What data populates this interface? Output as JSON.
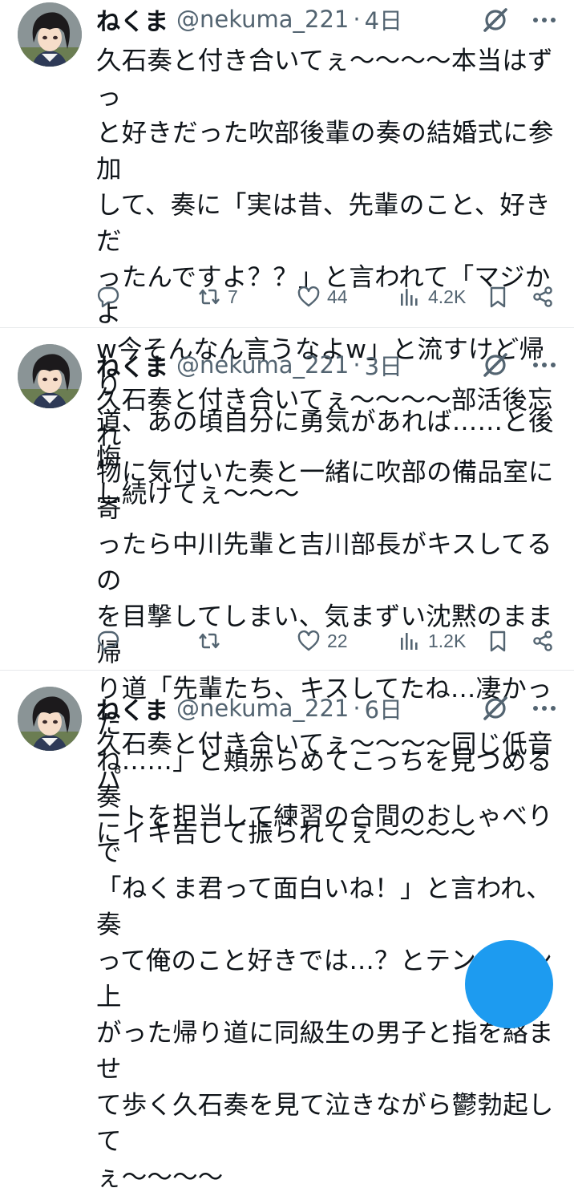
{
  "tweets": [
    {
      "name": "ねくま",
      "handle": "@nekuma_221",
      "separator": "·",
      "time": "4日",
      "text": "久石奏と付き合いてぇ〜〜〜〜本当はずっ\nと好きだった吹部後輩の奏の結婚式に参加\nして、奏に「実は昔、先輩のこと、好きだ\nったんですよ？？」と言われて「マジかよ\nw今そんなん言うなよw」と流すけど帰り\n道、あの頃自分に勇気があれば……と後悔\nし続けてぇ〜〜〜",
      "reply_count": "",
      "retweet_count": "7",
      "like_count": "44",
      "view_count": "4.2K"
    },
    {
      "name": "ねくま",
      "handle": "@nekuma_221",
      "separator": "·",
      "time": "3日",
      "text": "久石奏と付き合いてぇ〜〜〜〜部活後忘れ\n物に気付いた奏と一緒に吹部の備品室に寄\nったら中川先輩と吉川部長がキスしてるの\nを目撃してしまい、気まずい沈黙のまま帰\nり道「先輩たち、キスしてたね…凄かった\nね……」と頬赤らめてこっちを見つめる奏\nにイキ告して振られてぇ〜〜〜〜",
      "reply_count": "",
      "retweet_count": "",
      "like_count": "22",
      "view_count": "1.2K"
    },
    {
      "name": "ねくま",
      "handle": "@nekuma_221",
      "separator": "·",
      "time": "6日",
      "text": "久石奏と付き合いてぇ〜〜〜〜同じ低音パ\nートを担当して練習の合間のおしゃべりで\n「ねくま君って面白いね！」と言われ、奏\nって俺のこと好きでは…？とテンション上\nがった帰り道に同級生の男子と指を絡ませ\nて歩く久石奏を見て泣きながら鬱勃起して\nぇ〜〜〜〜"
    }
  ],
  "icons": {
    "reply": "reply-icon",
    "retweet": "retweet-icon",
    "like": "heart-icon",
    "views": "views-icon",
    "bookmark": "bookmark-icon",
    "share": "share-icon",
    "grok": "grok-icon",
    "more": "more-icon"
  },
  "colors": {
    "text": "#0f1419",
    "secondary": "#536471",
    "accent": "#1d9bf0",
    "divider": "#e6e9eb"
  }
}
